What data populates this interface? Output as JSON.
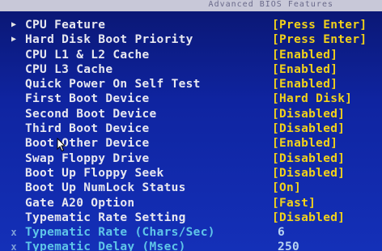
{
  "header": {
    "title": "Advanced BIOS Features"
  },
  "items": [
    {
      "marker": "▶",
      "label": "CPU Feature",
      "value": "[Press Enter]",
      "inactive": false
    },
    {
      "marker": "▶",
      "label": "Hard Disk Boot Priority",
      "value": "[Press Enter]",
      "inactive": false
    },
    {
      "marker": "",
      "label": "CPU L1 & L2 Cache",
      "value": "[Enabled]",
      "inactive": false
    },
    {
      "marker": "",
      "label": "CPU L3 Cache",
      "value": "[Enabled]",
      "inactive": false
    },
    {
      "marker": "",
      "label": "Quick Power On Self Test",
      "value": "[Enabled]",
      "inactive": false
    },
    {
      "marker": "",
      "label": "First Boot Device",
      "value": "[Hard Disk]",
      "inactive": false
    },
    {
      "marker": "",
      "label": "Second Boot Device",
      "value": "[Disabled]",
      "inactive": false
    },
    {
      "marker": "",
      "label": "Third Boot Device",
      "value": "[Disabled]",
      "inactive": false
    },
    {
      "marker": "",
      "label": "Boot Other Device",
      "value": "[Enabled]",
      "inactive": false
    },
    {
      "marker": "",
      "label": "Swap Floppy Drive",
      "value": "[Disabled]",
      "inactive": false
    },
    {
      "marker": "",
      "label": "Boot Up Floppy Seek",
      "value": "[Disabled]",
      "inactive": false
    },
    {
      "marker": "",
      "label": "Boot Up NumLock Status",
      "value": "[On]",
      "inactive": false
    },
    {
      "marker": "",
      "label": "Gate A20 Option",
      "value": "[Fast]",
      "inactive": false
    },
    {
      "marker": "",
      "label": "Typematic Rate Setting",
      "value": "[Disabled]",
      "inactive": false
    },
    {
      "marker": "x",
      "label": "Typematic Rate (Chars/Sec)",
      "value": "6",
      "inactive": true
    },
    {
      "marker": "x",
      "label": "Typematic Delay (Msec)",
      "value": "250",
      "inactive": true
    }
  ],
  "colors": {
    "background": "#1430b8",
    "label": "#e8e8f0",
    "value": "#f2d21a",
    "inactive_label": "#5fc6e8"
  },
  "icons": {
    "submenu": "triangle-right-icon",
    "disabled": "x-icon",
    "pointer": "mouse-cursor-icon"
  }
}
